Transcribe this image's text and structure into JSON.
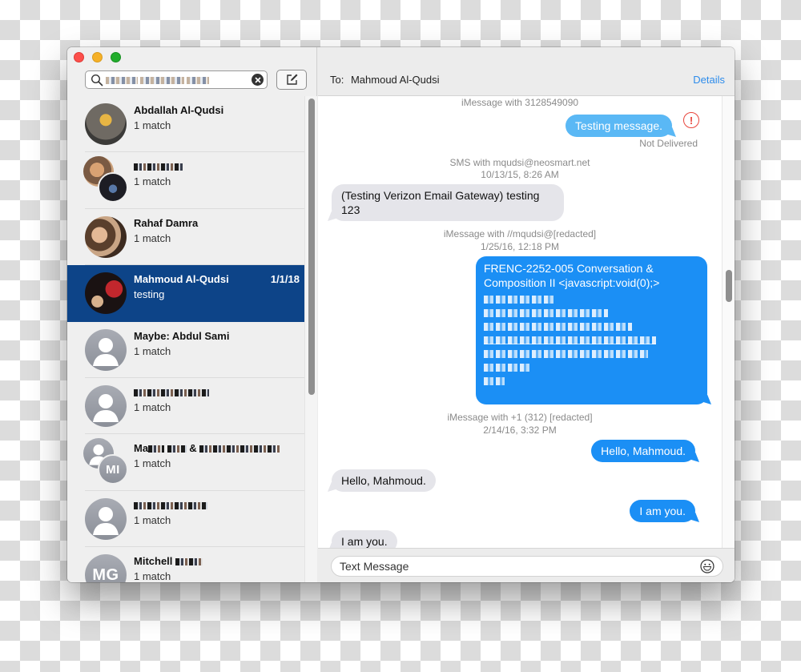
{
  "window": {
    "traffic_lights": [
      "close",
      "minimize",
      "maximize"
    ]
  },
  "sidebar": {
    "search": {
      "value": "[redacted search query]",
      "icons": {
        "search": "magnifier-icon",
        "clear": "clear-x-icon"
      }
    },
    "compose_icon": "compose-pencil-icon",
    "conversations": [
      {
        "name": "Abdallah Al-Qudsi",
        "subtitle": "1 match",
        "date": "",
        "avatar": "photo",
        "selected": false
      },
      {
        "name": "[redacted]",
        "subtitle": "1 match",
        "date": "",
        "avatar": "group-photo",
        "selected": false
      },
      {
        "name": "Rahaf Damra",
        "subtitle": "1 match",
        "date": "",
        "avatar": "photo",
        "selected": false
      },
      {
        "name": "Mahmoud Al-Qudsi",
        "subtitle": "testing",
        "date": "1/1/18",
        "avatar": "photo",
        "selected": true
      },
      {
        "name": "Maybe: Abdul Sami",
        "subtitle": "1 match",
        "date": "",
        "avatar": "placeholder-person",
        "selected": false
      },
      {
        "name": "[redacted]",
        "subtitle": "1 match",
        "date": "",
        "avatar": "placeholder-person",
        "selected": false
      },
      {
        "name": "Mau[redacted] & [redacted]",
        "subtitle": "1 match",
        "date": "",
        "avatar": "group-placeholder",
        "initials": "MI",
        "selected": false
      },
      {
        "name": "[redacted]",
        "subtitle": "1 match",
        "date": "",
        "avatar": "placeholder-person",
        "selected": false
      },
      {
        "name": "Mitchell [redacted]",
        "subtitle": "1 match",
        "date": "",
        "avatar": "initials",
        "initials": "MG",
        "selected": false
      }
    ]
  },
  "conversation": {
    "to_label": "To:",
    "recipient": "Mahmoud Al-Qudsi",
    "details_label": "Details",
    "items": [
      {
        "type": "header",
        "text": "iMessage with 3128549090"
      },
      {
        "type": "message",
        "dir": "out",
        "text": "Testing message.",
        "status": "Not Delivered",
        "status_icon": "exclamation-circle-icon"
      },
      {
        "type": "header",
        "text": "SMS with mqudsi@neosmart.net"
      },
      {
        "type": "header",
        "text": "10/13/15, 8:26 AM"
      },
      {
        "type": "message",
        "dir": "in",
        "text": "(Testing Verizon Email Gateway) testing 123"
      },
      {
        "type": "header",
        "text": "iMessage with //mqudsi@[redacted]"
      },
      {
        "type": "header",
        "text": "1/25/16, 12:18 PM"
      },
      {
        "type": "message",
        "dir": "out",
        "text": "FRENC-2252-005 Conversation & Composition II <javascript:void(0);>",
        "extra": "[7 redacted lines]"
      },
      {
        "type": "header",
        "text": "iMessage with +1 (312) [redacted]"
      },
      {
        "type": "header",
        "text": "2/14/16, 3:32 PM"
      },
      {
        "type": "message",
        "dir": "out",
        "text": "Hello, Mahmoud."
      },
      {
        "type": "message",
        "dir": "in",
        "text": "Hello, Mahmoud."
      },
      {
        "type": "message",
        "dir": "out",
        "text": "I am you."
      },
      {
        "type": "message",
        "dir": "in",
        "text": "I am you."
      }
    ],
    "input_placeholder": "Text Message",
    "emoji_icon": "emoji-smiley-icon"
  },
  "colors": {
    "selected_row": "#0d4488",
    "outgoing_bubble": "#1b8ff5",
    "undelivered_bubble": "#5ab8f5",
    "incoming_bubble": "#e5e5ea",
    "link": "#2d8ceb",
    "error": "#e8453c"
  }
}
